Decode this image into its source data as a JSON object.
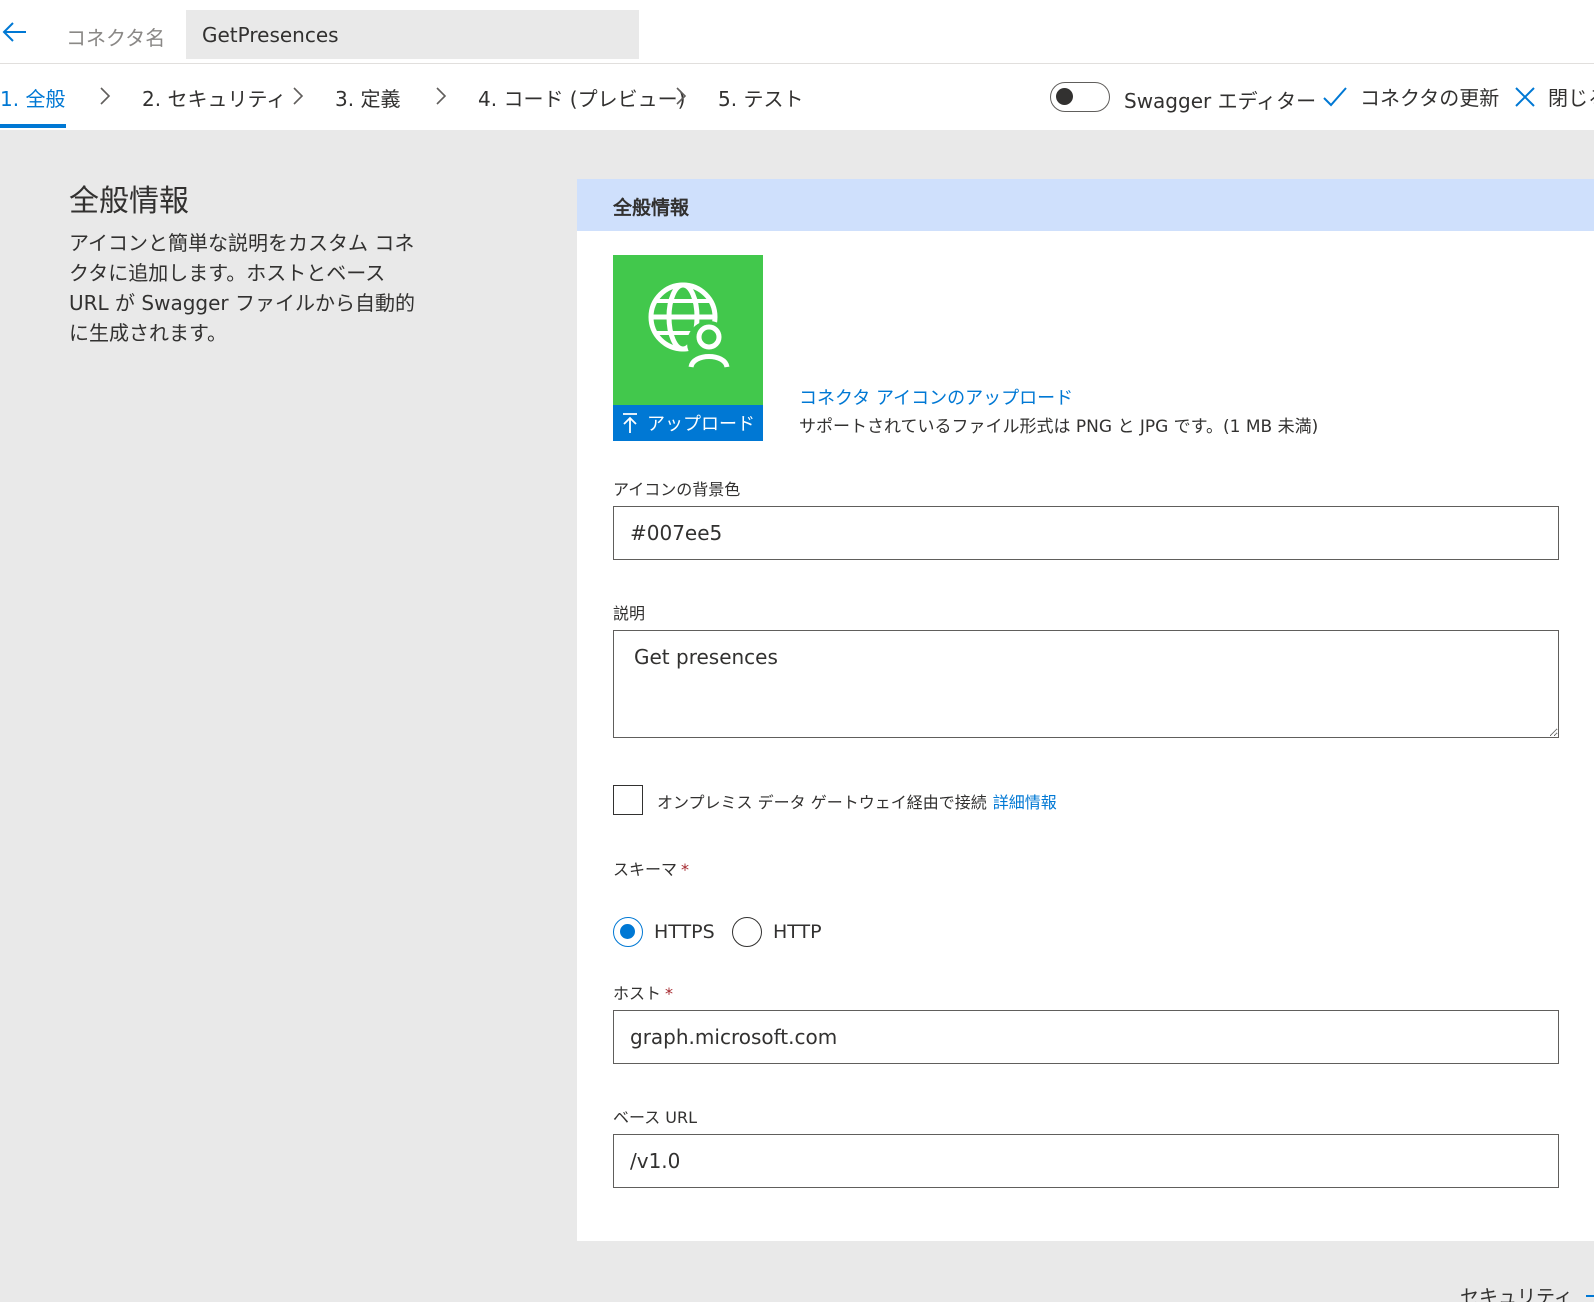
{
  "header": {
    "connector_label": "コネクタ名",
    "connector_name": "GetPresences"
  },
  "tabs": [
    {
      "label": "1. 全般",
      "active": true
    },
    {
      "label": "2. セキュリティ",
      "active": false
    },
    {
      "label": "3. 定義",
      "active": false
    },
    {
      "label": "4. コード (プレビュー)",
      "active": false
    },
    {
      "label": "5. テスト",
      "active": false
    }
  ],
  "commands": {
    "swagger_toggle_label": "Swagger エディター",
    "swagger_toggle_on": false,
    "update_label": "コネクタの更新",
    "close_label": "閉じる"
  },
  "side": {
    "title": "全般情報",
    "description": "アイコンと簡単な説明をカスタム コネクタに追加します。ホストとベース URL が Swagger ファイルから自動的に生成されます。"
  },
  "panel": {
    "header": "全般情報",
    "icon_bg_color": "#42c84c",
    "upload_button": "アップロード",
    "upload_link": "コネクタ アイコンのアップロード",
    "upload_note": "サポートされているファイル形式は PNG と JPG です。(1 MB 未満)",
    "icon_bg_label": "アイコンの背景色",
    "icon_bg_value": "#007ee5",
    "description_label": "説明",
    "description_value": "Get presences",
    "gateway_label": "オンプレミス データ ゲートウェイ経由で接続",
    "gateway_link": "詳細情報",
    "gateway_checked": false,
    "scheme_label": "スキーマ",
    "scheme_options": [
      {
        "label": "HTTPS",
        "checked": true
      },
      {
        "label": "HTTP",
        "checked": false
      }
    ],
    "host_label": "ホスト",
    "host_value": "graph.microsoft.com",
    "base_url_label": "ベース URL",
    "base_url_value": "/v1.0",
    "required_mark": "*"
  },
  "footer": {
    "next_label": "セキュリティ"
  },
  "colors": {
    "accent": "#0078d4",
    "panel_header": "#cfe0fc",
    "page_bg": "#e9e9e9"
  }
}
